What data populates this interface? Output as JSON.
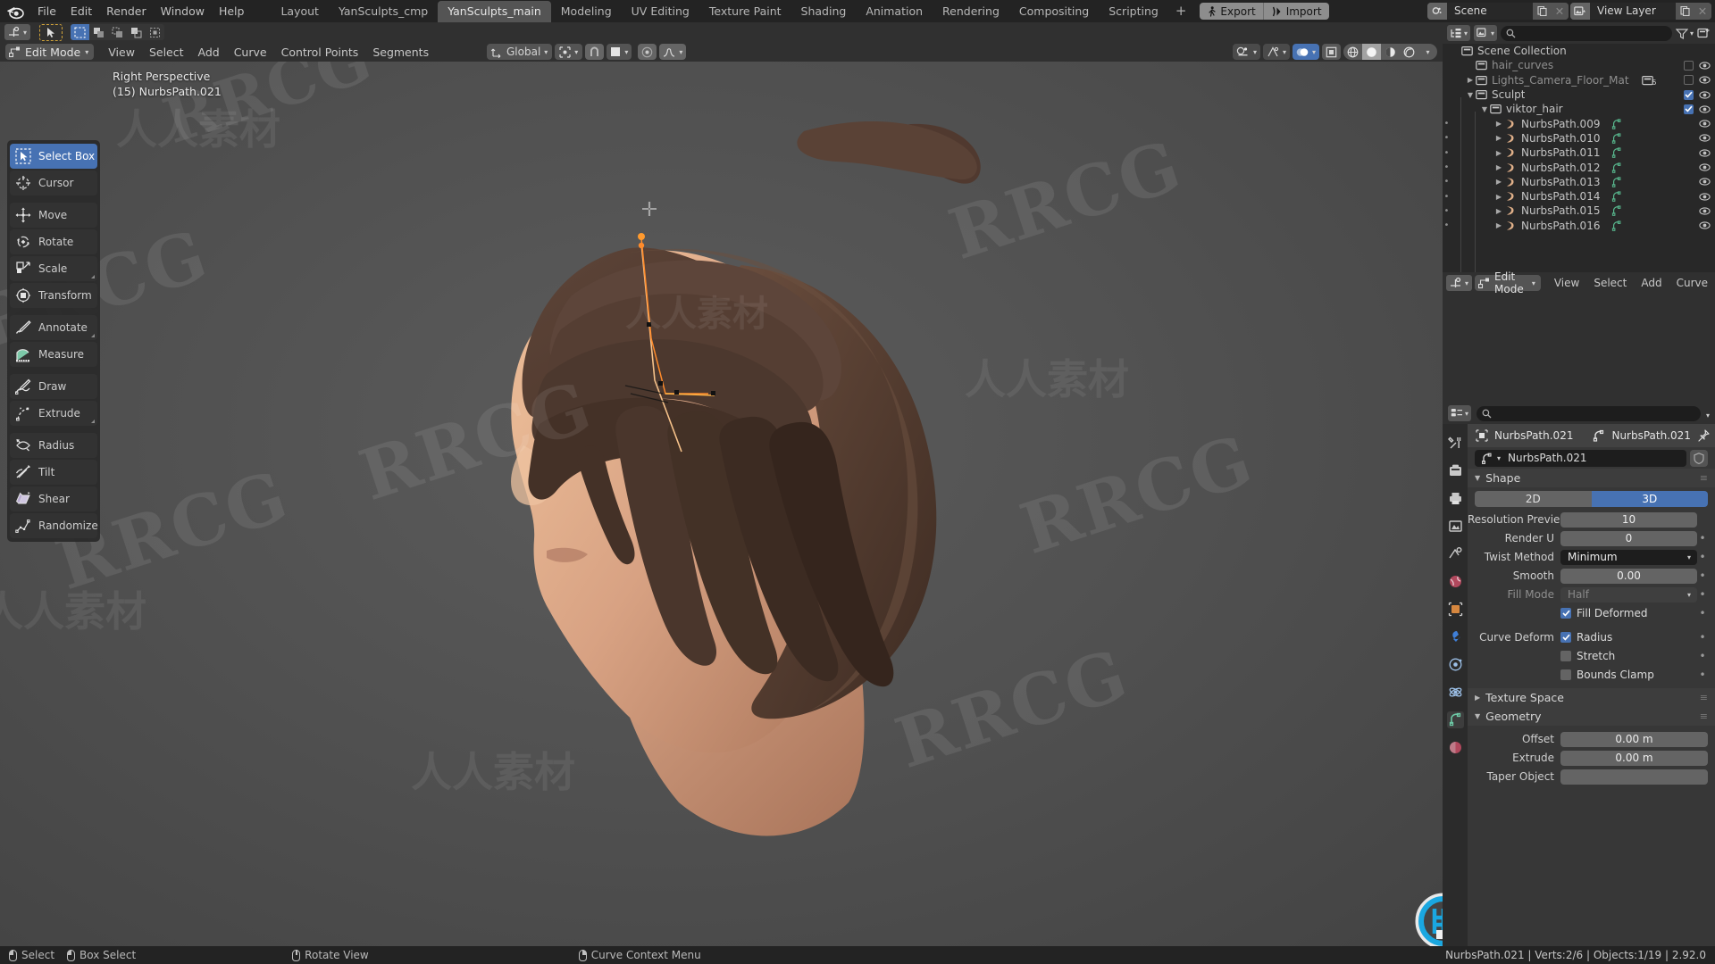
{
  "app": {
    "version": "2.92.0",
    "accent_blue": "#4772b3",
    "bg_dark": "#232323",
    "bg_panel": "#303030",
    "bg_field": "#646464",
    "curve_orange": "#ff8b2b"
  },
  "topbar": {
    "menus": [
      "File",
      "Edit",
      "Render",
      "Window",
      "Help"
    ],
    "workspace_tabs": [
      {
        "label": "Layout",
        "active": false
      },
      {
        "label": "YanSculpts_cmp",
        "active": false
      },
      {
        "label": "YanSculpts_main",
        "active": true
      },
      {
        "label": "Modeling",
        "active": false
      },
      {
        "label": "UV Editing",
        "active": false
      },
      {
        "label": "Texture Paint",
        "active": false
      },
      {
        "label": "Shading",
        "active": false
      },
      {
        "label": "Animation",
        "active": false
      },
      {
        "label": "Rendering",
        "active": false
      },
      {
        "label": "Compositing",
        "active": false
      },
      {
        "label": "Scripting",
        "active": false
      }
    ],
    "add_tab_label": "+",
    "addon_buttons": [
      {
        "label": "Export",
        "icon": "export-icon"
      },
      {
        "label": "Import",
        "icon": "import-icon"
      }
    ],
    "scene_name": "Scene",
    "view_layer_name": "View Layer"
  },
  "viewport_header": {
    "editor_type_icon": "editor-type-icon",
    "select_mode_tools": [
      "select-box",
      "select-extend",
      "select-subtract",
      "select-invert",
      "select-intersect"
    ],
    "mode": "Edit Mode",
    "menus": [
      "View",
      "Select",
      "Add",
      "Curve",
      "Control Points",
      "Segments"
    ],
    "transform_orientation": "Global",
    "pivot_icon": "pivot-point-icon",
    "snap_icon": "snap-magnet-icon",
    "snap_target_icon": "snap-increment-icon",
    "proportional_icon": "proportional-edit-icon",
    "falloff_icon": "proportional-falloff-icon",
    "overlay_toggle": "show-overlays-icon",
    "gizmo_toggle": "show-gizmo-icon",
    "xray_toggle": "toggle-xray-icon",
    "shading_modes": [
      "wireframe",
      "solid",
      "material-preview",
      "rendered"
    ],
    "shading_active": "solid"
  },
  "viewport": {
    "view_name": "Right Perspective",
    "active_object": "(15) NurbsPath.021",
    "toolbar": [
      {
        "label": "Select Box",
        "icon": "select-box-icon",
        "active": true,
        "group_end": false
      },
      {
        "label": "Cursor",
        "icon": "cursor-3d-icon",
        "active": false,
        "group_end": true
      },
      {
        "label": "Move",
        "icon": "move-icon",
        "active": false,
        "group_end": false
      },
      {
        "label": "Rotate",
        "icon": "rotate-icon",
        "active": false,
        "group_end": false
      },
      {
        "label": "Scale",
        "icon": "scale-icon",
        "active": false,
        "group_end": false
      },
      {
        "label": "Transform",
        "icon": "transform-icon",
        "active": false,
        "group_end": true
      },
      {
        "label": "Annotate",
        "icon": "annotate-icon",
        "active": false,
        "group_end": false
      },
      {
        "label": "Measure",
        "icon": "measure-icon",
        "active": false,
        "group_end": true
      },
      {
        "label": "Draw",
        "icon": "draw-icon",
        "active": false,
        "group_end": false
      },
      {
        "label": "Extrude",
        "icon": "extrude-icon",
        "active": false,
        "group_end": true
      },
      {
        "label": "Radius",
        "icon": "radius-icon",
        "active": false,
        "group_end": false
      },
      {
        "label": "Tilt",
        "icon": "tilt-icon",
        "active": false,
        "group_end": false
      },
      {
        "label": "Shear",
        "icon": "shear-icon",
        "active": false,
        "group_end": false
      },
      {
        "label": "Randomize",
        "icon": "randomize-icon",
        "active": false,
        "group_end": false
      }
    ],
    "watermarks": [
      "RRCG",
      "人人素材"
    ]
  },
  "outliner": {
    "display_mode_icon": "outliner-display-mode-icon",
    "filter_icon": "filter-funnel-icon",
    "new_collection_icon": "new-collection-icon",
    "search_placeholder": "",
    "rows": [
      {
        "label": "Scene Collection",
        "indent": 0,
        "icon": "collection-icon",
        "tri": "",
        "dot": false,
        "checkbox": null,
        "eye": false,
        "dim": false,
        "curve_icon": false
      },
      {
        "label": "hair_curves",
        "indent": 1,
        "icon": "collection-icon",
        "tri": "",
        "dot": false,
        "checkbox": "off",
        "eye": true,
        "dim": true,
        "curve_icon": false
      },
      {
        "label": "Lights_Camera_Floor_Mat",
        "indent": 1,
        "icon": "collection-icon",
        "tri": "right",
        "dot": false,
        "checkbox": "off",
        "eye": true,
        "dim": true,
        "curve_icon": false
      },
      {
        "label": "Sculpt",
        "indent": 1,
        "icon": "collection-icon",
        "tri": "down",
        "dot": false,
        "checkbox": "on",
        "eye": true,
        "dim": false,
        "curve_icon": false
      },
      {
        "label": "viktor_hair",
        "indent": 2,
        "icon": "collection-icon",
        "tri": "down",
        "dot": false,
        "checkbox": "on",
        "eye": true,
        "dim": false,
        "curve_icon": false
      },
      {
        "label": "NurbsPath.009",
        "indent": 3,
        "icon": "curve-obj-icon",
        "tri": "right",
        "dot": true,
        "checkbox": null,
        "eye": true,
        "dim": false,
        "curve_icon": true
      },
      {
        "label": "NurbsPath.010",
        "indent": 3,
        "icon": "curve-obj-icon",
        "tri": "right",
        "dot": true,
        "checkbox": null,
        "eye": true,
        "dim": false,
        "curve_icon": true
      },
      {
        "label": "NurbsPath.011",
        "indent": 3,
        "icon": "curve-obj-icon",
        "tri": "right",
        "dot": true,
        "checkbox": null,
        "eye": true,
        "dim": false,
        "curve_icon": true
      },
      {
        "label": "NurbsPath.012",
        "indent": 3,
        "icon": "curve-obj-icon",
        "tri": "right",
        "dot": true,
        "checkbox": null,
        "eye": true,
        "dim": false,
        "curve_icon": true
      },
      {
        "label": "NurbsPath.013",
        "indent": 3,
        "icon": "curve-obj-icon",
        "tri": "right",
        "dot": true,
        "checkbox": null,
        "eye": true,
        "dim": false,
        "curve_icon": true
      },
      {
        "label": "NurbsPath.014",
        "indent": 3,
        "icon": "curve-obj-icon",
        "tri": "right",
        "dot": true,
        "checkbox": null,
        "eye": true,
        "dim": false,
        "curve_icon": true
      },
      {
        "label": "NurbsPath.015",
        "indent": 3,
        "icon": "curve-obj-icon",
        "tri": "right",
        "dot": true,
        "checkbox": null,
        "eye": true,
        "dim": false,
        "curve_icon": true
      },
      {
        "label": "NurbsPath.016",
        "indent": 3,
        "icon": "curve-obj-icon",
        "tri": "right",
        "dot": true,
        "checkbox": null,
        "eye": true,
        "dim": false,
        "curve_icon": true
      }
    ],
    "lights_badge": "5"
  },
  "second_header": {
    "editor_icon": "editor-type-icon",
    "mode": "Edit Mode",
    "menus": [
      "View",
      "Select",
      "Add",
      "Curve"
    ]
  },
  "properties": {
    "search_placeholder": "",
    "breadcrumb": [
      {
        "label": "NurbsPath.021",
        "icon": "object-icon"
      },
      {
        "label": "NurbsPath.021",
        "icon": "curve-data-icon"
      }
    ],
    "pin_icon": "pin-icon",
    "datablock_name": "NurbsPath.021",
    "datablock_icon": "curve-data-icon",
    "shield_icon": "fake-user-shield-icon",
    "panels": [
      {
        "name": "Shape",
        "open": true
      },
      {
        "name": "Texture Space",
        "open": false
      },
      {
        "name": "Geometry",
        "open": true
      }
    ],
    "shape": {
      "dimension_toggle": {
        "options": [
          "2D",
          "3D"
        ],
        "selected": "3D"
      },
      "fields": [
        {
          "label": "Resolution Previe...",
          "value": "10",
          "type": "number",
          "animdot": false,
          "dim": false
        },
        {
          "label": "Render U",
          "value": "0",
          "type": "number",
          "animdot": true,
          "dim": false
        },
        {
          "label": "Twist Method",
          "value": "Minimum",
          "type": "dropdown",
          "animdot": true,
          "dim": false
        },
        {
          "label": "Smooth",
          "value": "0.00",
          "type": "number",
          "animdot": true,
          "dim": false
        },
        {
          "label": "Fill Mode",
          "value": "Half",
          "type": "dropdown",
          "animdot": true,
          "dim": true
        }
      ],
      "checkboxes": [
        {
          "label": "",
          "text": "Fill Deformed",
          "checked": true,
          "animdot": true
        },
        {
          "label": "Curve Deform",
          "text": "Radius",
          "checked": true,
          "animdot": true
        },
        {
          "label": "",
          "text": "Stretch",
          "checked": false,
          "animdot": true
        },
        {
          "label": "",
          "text": "Bounds Clamp",
          "checked": false,
          "animdot": true
        }
      ]
    },
    "geometry": {
      "fields": [
        {
          "label": "Offset",
          "value": "0.00 m"
        },
        {
          "label": "Extrude",
          "value": "0.00 m"
        },
        {
          "label": "Taper Object",
          "value": ""
        }
      ]
    }
  },
  "statusbar": {
    "hints": [
      {
        "mouse": "l",
        "label": "Select"
      },
      {
        "mouse": "l2",
        "label": "Box Select"
      },
      {
        "mouse": "m",
        "label": "Rotate View"
      },
      {
        "mouse": "r",
        "label": "Curve Context Menu"
      }
    ],
    "info": "NurbsPath.021 | Verts:2/6 | Objects:1/19 | 2.92.0"
  }
}
